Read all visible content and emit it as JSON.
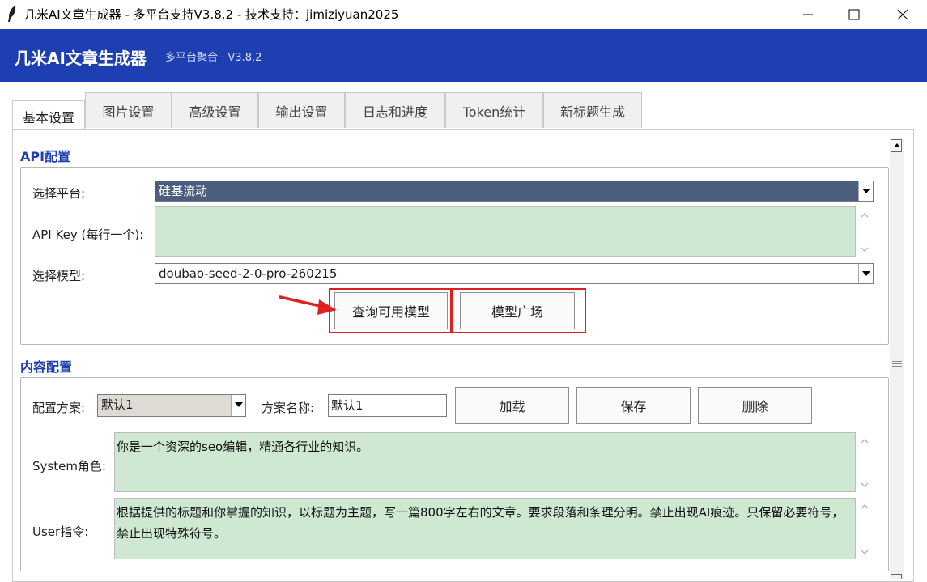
{
  "window": {
    "title": "几米AI文章生成器 - 多平台支持V3.8.2 - 技术支持：jimiziyuan2025",
    "icon": "feather-icon",
    "controls": [
      "minimize-icon",
      "maximize-icon",
      "close-icon"
    ]
  },
  "header": {
    "app_name": "几米AI文章生成器",
    "subtitle": "多平台聚合 · V3.8.2",
    "background": "#1e3fb1"
  },
  "tabs": [
    {
      "label": "基本设置",
      "active": true
    },
    {
      "label": "图片设置"
    },
    {
      "label": "高级设置"
    },
    {
      "label": "输出设置"
    },
    {
      "label": "日志和进度"
    },
    {
      "label": "Token统计"
    },
    {
      "label": "新标题生成"
    }
  ],
  "api_config": {
    "title": "API配置",
    "platform_label": "选择平台:",
    "platform_value": "硅基流动",
    "api_key_label": "API Key (每行一个):",
    "api_key_value": "",
    "model_label": "选择模型:",
    "model_value": "doubao-seed-2-0-pro-260215",
    "query_models_button": "查询可用模型",
    "model_market_button": "模型广场"
  },
  "content_config": {
    "title": "内容配置",
    "scheme_label": "配置方案:",
    "scheme_value": "默认1",
    "scheme_name_label": "方案名称:",
    "scheme_name_value": "默认1",
    "load_button": "加载",
    "save_button": "保存",
    "delete_button": "删除",
    "system_label": "System角色:",
    "system_value": "你是一个资深的seo编辑，精通各行业的知识。",
    "user_label": "User指令:",
    "user_value": "根据提供的标题和你掌握的知识，以标题为主题，写一篇800字左右的文章。要求段落和条理分明。禁止出现AI痕迹。只保留必要符号，禁止出现特殊符号。"
  },
  "colors": {
    "accent": "#1e3fb1",
    "text_area_bg": "#cfe8d1",
    "selected_combo_bg": "#4a5f7f",
    "annotation_red": "#e02020"
  }
}
